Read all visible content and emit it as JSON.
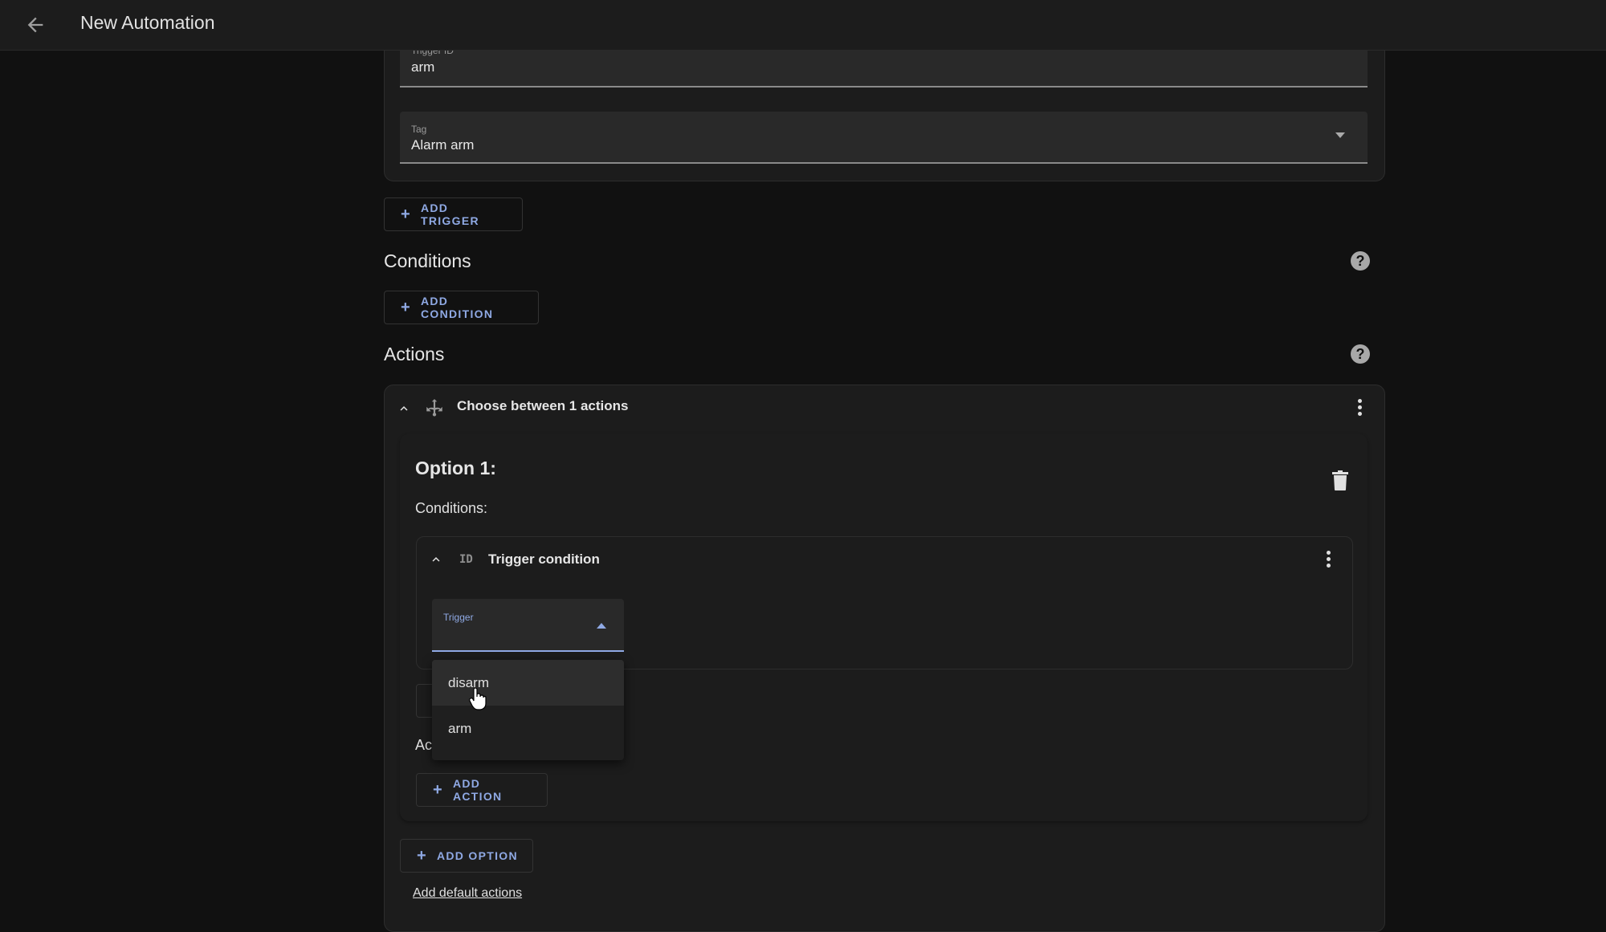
{
  "header": {
    "title": "New Automation",
    "back_icon": "arrow-left-icon"
  },
  "trigger_card": {
    "trigger_id_label": "Trigger ID",
    "trigger_id_value": "arm",
    "tag_label": "Tag",
    "tag_value": "Alarm arm"
  },
  "buttons": {
    "add_trigger": "ADD TRIGGER",
    "add_condition": "ADD CONDITION",
    "add_action": "ADD ACTION",
    "add_option": "ADD OPTION",
    "plus": "+"
  },
  "sections": {
    "conditions": "Conditions",
    "actions": "Actions",
    "help": "?"
  },
  "choose_action": {
    "title": "Choose between 1 actions",
    "option_title": "Option 1:",
    "conditions_label": "Conditions:",
    "actions_label_partial": "Ac",
    "add_default_actions": "Add default actions"
  },
  "trigger_condition": {
    "id_badge": "ID",
    "title": "Trigger condition",
    "select_label": "Trigger",
    "select_value": "",
    "options": [
      "disarm",
      "arm"
    ],
    "hovered_option": "disarm"
  },
  "colors": {
    "accent": "#8fa9e4",
    "background": "#111111",
    "card": "#1c1c1c",
    "field": "#292929"
  }
}
